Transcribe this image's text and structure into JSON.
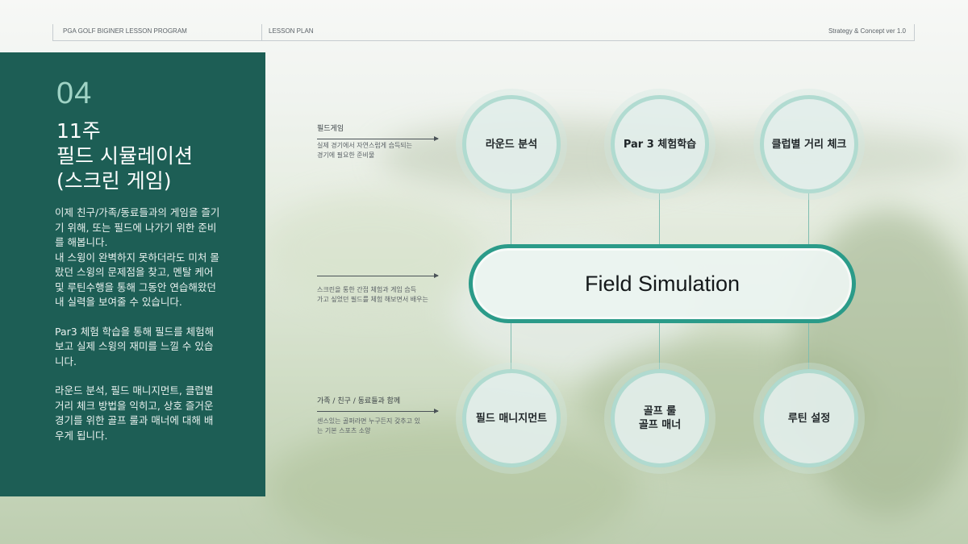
{
  "header": {
    "program": "PGA GOLF BIGINER LESSON PROGRAM",
    "section": "LESSON PLAN",
    "version": "Strategy & Concept  ver 1.0"
  },
  "panel": {
    "number": "04",
    "title_lines": [
      "11주",
      "필드 시뮬레이션",
      "(스크린 게임)"
    ],
    "paragraphs": [
      "이제 친구/가족/동료들과의 게임을 즐기기 위해, 또는 필드에 나가기 위한 준비를 해봅니다.\n내 스윙이 완벽하지 못하더라도 미처 몰랐던 스윙의 문제점을 찾고, 멘탈 케어 및 루틴수행을 통해 그동안 연습해왔던 내 실력을 보여줄 수 있습니다.",
      "Par3 체험 학습을 통해 필드를 체험해보고 실제 스윙의  재미를 느낄 수 있습니다.",
      " 라운드 분석, 필드 매니지먼트, 클럽별 거리 체크 방법을 익히고, 상호 즐거운 경기를 위한 골프 룰과 매너에 대해 배우게 됩니다."
    ]
  },
  "notes": [
    {
      "heading": "필드게임",
      "body": "실제 경기에서 자연스럽게 습득되는\n경기에 필요한 준비물"
    },
    {
      "heading": "",
      "body": "스크린을 통한 간접 체험과 게임 습득\n가고 싶었던 필드를 체험 해보면서 배우는"
    },
    {
      "heading": "가족 / 친구 / 동료들과 함께",
      "body": "센스있는 골퍼라면 누구든지 갖추고 있\n는 기본 스포츠 소양"
    }
  ],
  "diagram": {
    "center": "Field Simulation",
    "top": [
      "라운드 분석",
      "Par 3 체험학습",
      "클럽별 거리 체크"
    ],
    "bottom": [
      "필드 매니지먼트",
      "골프 룰\n골프 매너",
      "루틴 설정"
    ]
  },
  "colors": {
    "panel": "#1d5e55",
    "accent": "#2b9b89",
    "number": "#9fd3c5"
  }
}
